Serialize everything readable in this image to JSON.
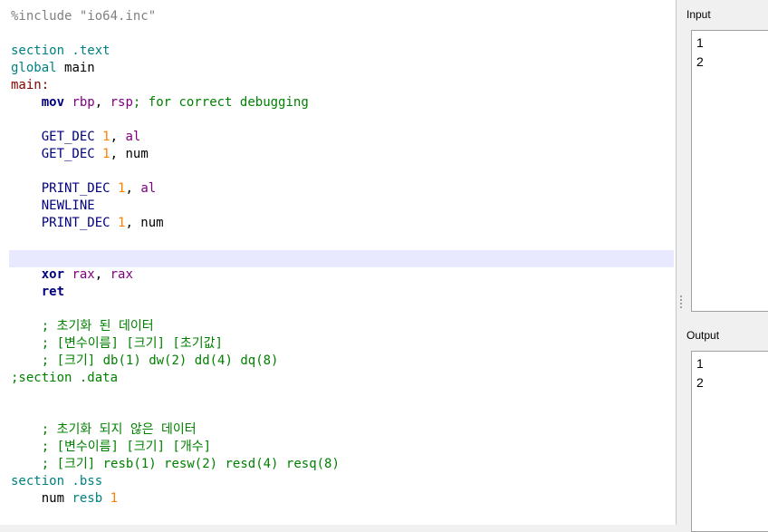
{
  "editor": {
    "lines": [
      {
        "t": [
          [
            "%include ",
            "pre"
          ],
          [
            "\"io64.inc\"",
            "str"
          ]
        ]
      },
      {
        "t": []
      },
      {
        "t": [
          [
            "section .text",
            "dir"
          ]
        ]
      },
      {
        "t": [
          [
            "global ",
            "dir"
          ],
          [
            "main",
            ""
          ]
        ]
      },
      {
        "t": [
          [
            "main:",
            "lbl"
          ]
        ]
      },
      {
        "t": [
          [
            "    ",
            ""
          ],
          [
            "mov",
            "ins"
          ],
          [
            " ",
            ""
          ],
          [
            "rbp",
            "reg"
          ],
          [
            ", ",
            ""
          ],
          [
            "rsp",
            "reg"
          ],
          [
            "; for correct debugging",
            "cmt"
          ]
        ]
      },
      {
        "t": []
      },
      {
        "t": [
          [
            "    ",
            ""
          ],
          [
            "GET_DEC",
            "mac"
          ],
          [
            " ",
            ""
          ],
          [
            "1",
            "num"
          ],
          [
            ", ",
            ""
          ],
          [
            "al",
            "reg"
          ]
        ]
      },
      {
        "t": [
          [
            "    ",
            ""
          ],
          [
            "GET_DEC",
            "mac"
          ],
          [
            " ",
            ""
          ],
          [
            "1",
            "num"
          ],
          [
            ", num",
            ""
          ]
        ]
      },
      {
        "t": []
      },
      {
        "t": [
          [
            "    ",
            ""
          ],
          [
            "PRINT_DEC",
            "mac"
          ],
          [
            " ",
            ""
          ],
          [
            "1",
            "num"
          ],
          [
            ", ",
            ""
          ],
          [
            "al",
            "reg"
          ]
        ]
      },
      {
        "t": [
          [
            "    ",
            ""
          ],
          [
            "NEWLINE",
            "mac"
          ]
        ]
      },
      {
        "t": [
          [
            "    ",
            ""
          ],
          [
            "PRINT_DEC",
            "mac"
          ],
          [
            " ",
            ""
          ],
          [
            "1",
            "num"
          ],
          [
            ", num",
            ""
          ]
        ]
      },
      {
        "t": []
      },
      {
        "t": []
      },
      {
        "t": [
          [
            "    ",
            ""
          ],
          [
            "xor",
            "ins"
          ],
          [
            " ",
            ""
          ],
          [
            "rax",
            "reg"
          ],
          [
            ", ",
            ""
          ],
          [
            "rax",
            "reg"
          ]
        ]
      },
      {
        "t": [
          [
            "    ",
            ""
          ],
          [
            "ret",
            "ins"
          ]
        ]
      },
      {
        "t": []
      },
      {
        "t": [
          [
            "    ; 초기화 된 데이터",
            "cmt"
          ]
        ]
      },
      {
        "t": [
          [
            "    ; [변수이름] [크기] [초기값]",
            "cmt"
          ]
        ]
      },
      {
        "t": [
          [
            "    ; [크기] db(1) dw(2) dd(4) dq(8)",
            "cmt"
          ]
        ]
      },
      {
        "t": [
          [
            ";section .data",
            "cmt"
          ]
        ]
      },
      {
        "t": []
      },
      {
        "t": []
      },
      {
        "t": [
          [
            "    ; 초기화 되지 않은 데이터",
            "cmt"
          ]
        ]
      },
      {
        "t": [
          [
            "    ; [변수이름] [크기] [개수]",
            "cmt"
          ]
        ]
      },
      {
        "t": [
          [
            "    ; [크기] resb(1) resw(2) resd(4) resq(8)",
            "cmt"
          ]
        ]
      },
      {
        "t": [
          [
            "section .bss",
            "dir"
          ]
        ]
      },
      {
        "t": [
          [
            "    num ",
            ""
          ],
          [
            "resb",
            "dir"
          ],
          [
            " ",
            ""
          ],
          [
            "1",
            "num"
          ]
        ]
      }
    ]
  },
  "input": {
    "label": "Input",
    "lines": [
      "1",
      "2"
    ]
  },
  "output": {
    "label": "Output",
    "lines": [
      "1",
      "2"
    ]
  }
}
